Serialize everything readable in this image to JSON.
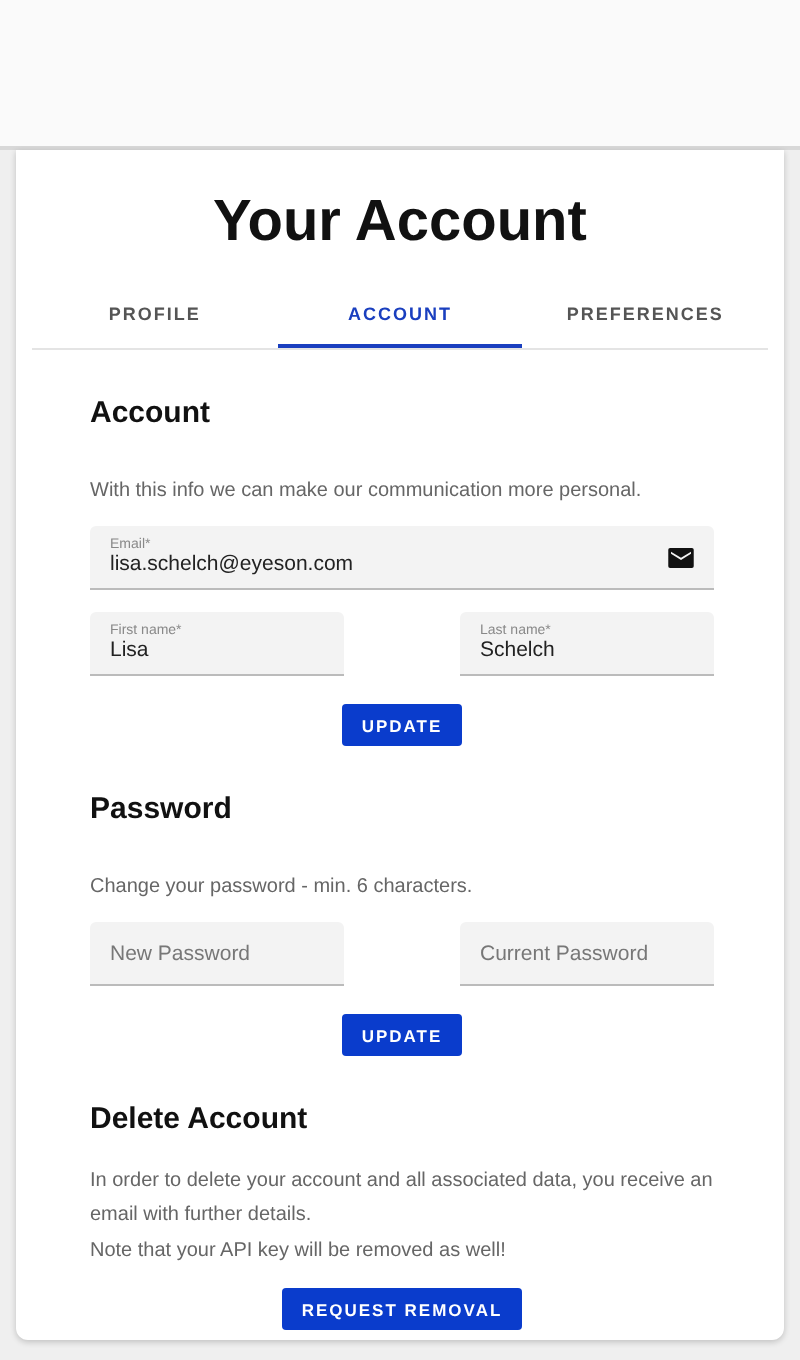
{
  "title": "Your Account",
  "tabs": [
    {
      "label": "PROFILE",
      "selected": false
    },
    {
      "label": "ACCOUNT",
      "selected": true
    },
    {
      "label": "PREFERENCES",
      "selected": false
    }
  ],
  "sections": [
    {
      "heading": "Account",
      "paragraphs": [
        "With this info we can make our communication more personal."
      ],
      "rows": [
        [
          {
            "label": "Email*",
            "value": "lisa.schelch@eyeson.com",
            "kind": "email"
          }
        ],
        [
          {
            "label": "First name*",
            "value": "Lisa"
          },
          {
            "label": "Last name*",
            "value": "Schelch"
          }
        ]
      ],
      "button": "UPDATE"
    },
    {
      "heading": "Password",
      "paragraphs": [
        "Change your password - min. 6 characters."
      ],
      "rows": [
        [
          {
            "placeholder": "New Password"
          },
          {
            "placeholder": "Current Password"
          }
        ]
      ],
      "button": "UPDATE"
    },
    {
      "heading": "Delete Account",
      "paragraphs": [
        "In order to delete your account and all associated data, you receive an email with further details.",
        "Note that your API key will be removed as well!"
      ],
      "button": "REQUEST REMOVAL"
    }
  ]
}
